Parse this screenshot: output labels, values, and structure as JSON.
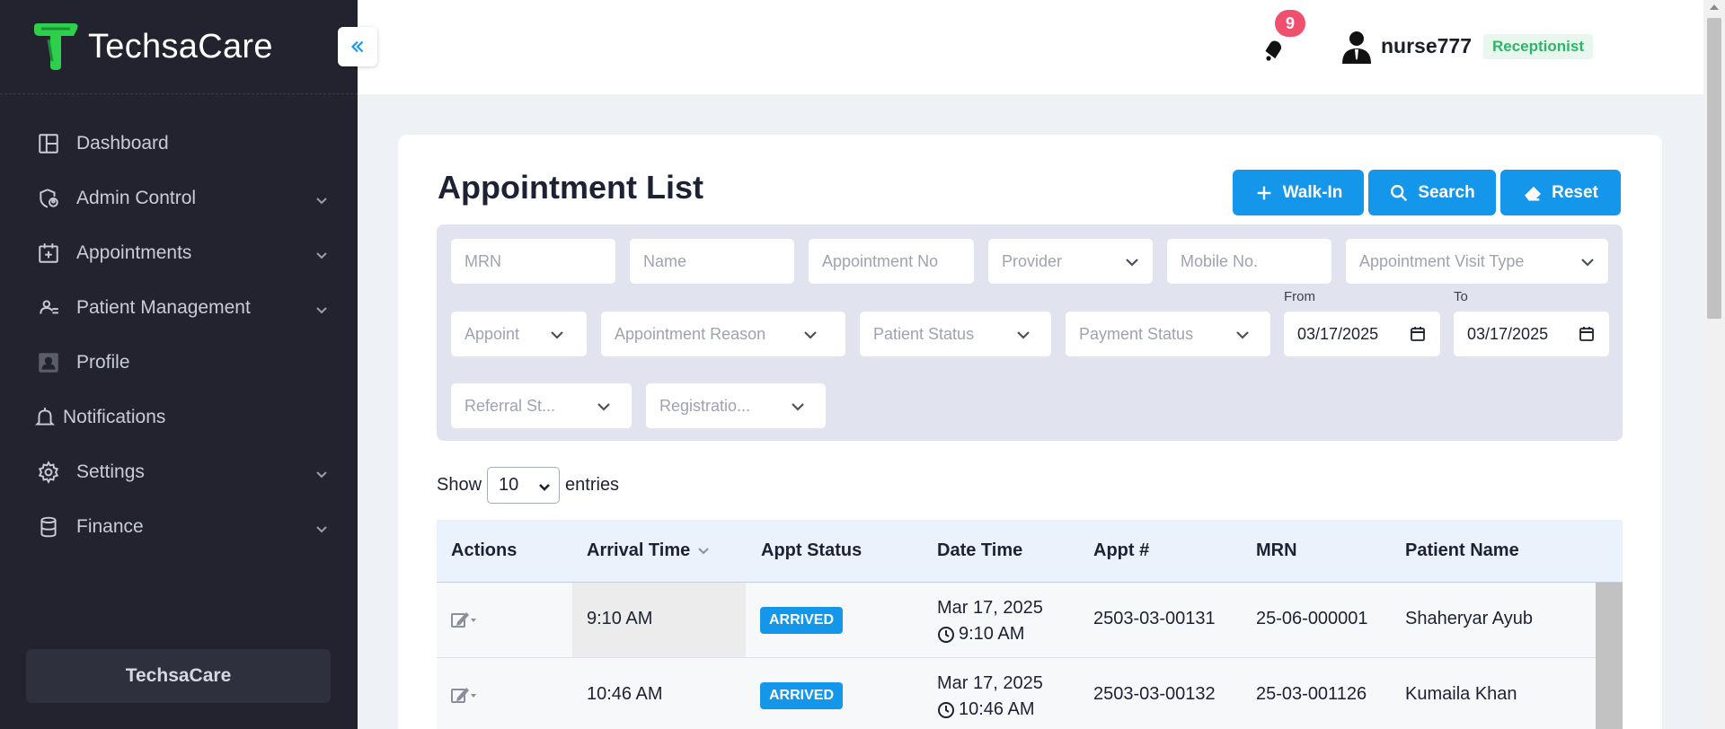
{
  "brand": {
    "name": "TechsaCare"
  },
  "sidebar": {
    "items": [
      {
        "label": "Dashboard",
        "icon": "dashboard-icon",
        "has_children": false
      },
      {
        "label": "Admin Control",
        "icon": "admin-shield-icon",
        "has_children": true
      },
      {
        "label": "Appointments",
        "icon": "appointments-icon",
        "has_children": true
      },
      {
        "label": "Patient Management",
        "icon": "patient-icon",
        "has_children": true
      },
      {
        "label": "Profile",
        "icon": "profile-icon",
        "has_children": false
      },
      {
        "label": "Notifications",
        "icon": "bell-icon",
        "has_children": false
      },
      {
        "label": "Settings",
        "icon": "gear-icon",
        "has_children": true
      },
      {
        "label": "Finance",
        "icon": "database-icon",
        "has_children": true
      }
    ],
    "footer": "TechsaCare"
  },
  "header": {
    "notification_count": "9",
    "username": "nurse777",
    "role": "Receptionist"
  },
  "main": {
    "title": "Appointment List",
    "buttons": {
      "walkin": "Walk-In",
      "search": "Search",
      "reset": "Reset"
    },
    "filters": {
      "mrn": "MRN",
      "name": "Name",
      "appointment_no": "Appointment No",
      "provider": "Provider",
      "mobile": "Mobile No.",
      "visit_type": "Appointment Visit Type",
      "appoint": "Appoint",
      "reason": "Appointment Reason",
      "patient_status": "Patient Status",
      "payment_status": "Payment Status",
      "from_label": "From",
      "from_value": "03/17/2025",
      "to_label": "To",
      "to_value": "03/17/2025",
      "referral": "Referral St...",
      "registration": "Registratio..."
    },
    "show": {
      "prefix": "Show",
      "value": "10",
      "suffix": "entries"
    },
    "table": {
      "headers": [
        "Actions",
        "Arrival Time",
        "Appt Status",
        "Date Time",
        "Appt #",
        "MRN",
        "Patient Name"
      ],
      "rows": [
        {
          "arrival": "9:10 AM",
          "status": "ARRIVED",
          "date": "Mar 17, 2025",
          "time": "9:10 AM",
          "appt": "2503-03-00131",
          "mrn": "25-06-000001",
          "patient": "Shaheryar Ayub"
        },
        {
          "arrival": "10:46 AM",
          "status": "ARRIVED",
          "date": "Mar 17, 2025",
          "time": "10:46 AM",
          "appt": "2503-03-00132",
          "mrn": "25-03-001126",
          "patient": "Kumaila Khan"
        }
      ]
    }
  },
  "colors": {
    "accent": "#1496ea",
    "sidebar_bg": "#22232f",
    "badge_red": "#f0506e",
    "role_green": "#2fb56b"
  }
}
